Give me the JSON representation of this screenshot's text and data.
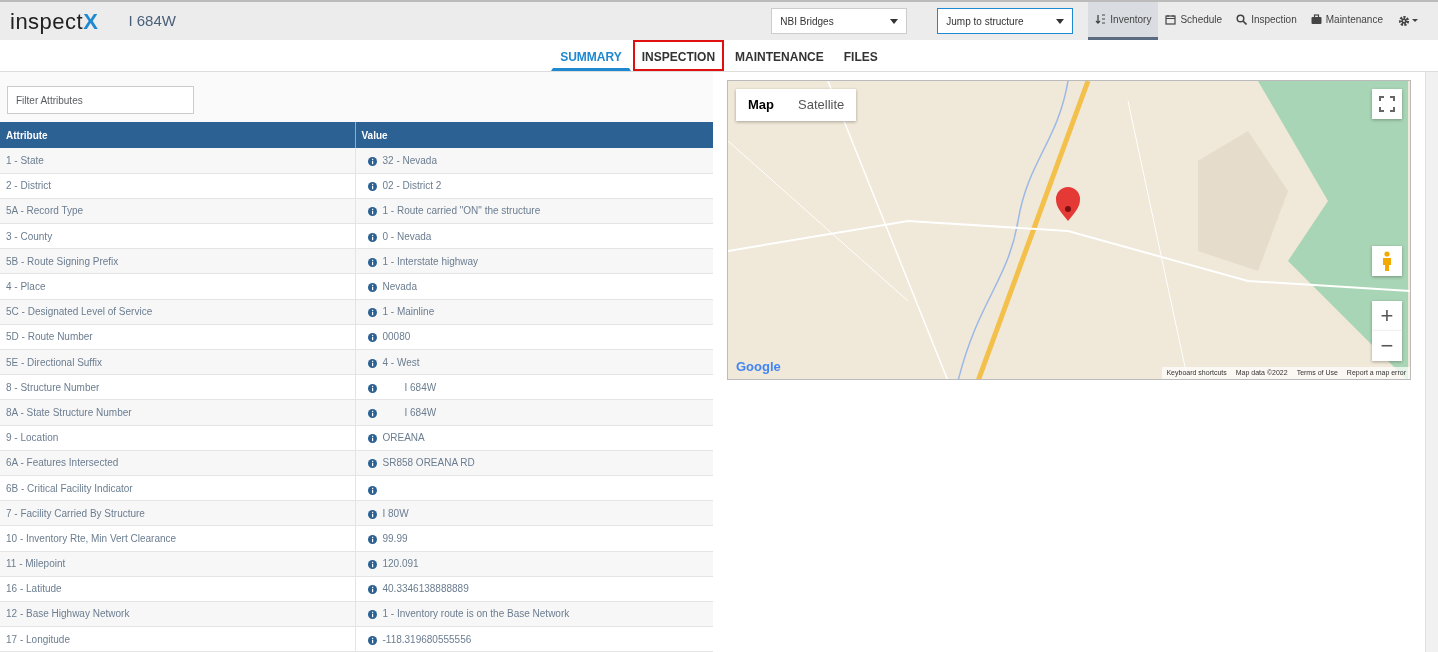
{
  "header": {
    "logo": {
      "text": "inspect",
      "accent": "X"
    },
    "structure": "I 684W",
    "selects": [
      {
        "value": "NBI Bridges",
        "focused": false
      },
      {
        "value": "Jump to structure",
        "focused": true
      }
    ],
    "nav": [
      {
        "label": "Inventory",
        "kind": "sort",
        "selected": true
      },
      {
        "label": "Schedule",
        "kind": "calendar",
        "selected": false
      },
      {
        "label": "Inspection",
        "kind": "search",
        "selected": false
      },
      {
        "label": "Maintenance",
        "kind": "briefcase",
        "selected": false
      }
    ]
  },
  "tabs": [
    {
      "label": "SUMMARY",
      "selected": true,
      "highlighted": false
    },
    {
      "label": "INSPECTION",
      "selected": false,
      "highlighted": true
    },
    {
      "label": "MAINTENANCE",
      "selected": false,
      "highlighted": false
    },
    {
      "label": "FILES",
      "selected": false,
      "highlighted": false
    }
  ],
  "filter": {
    "placeholder": "Filter Attributes"
  },
  "table": {
    "columns": [
      "Attribute",
      "Value"
    ],
    "rows": [
      {
        "attribute": "1 - State",
        "value": "32 - Nevada",
        "indented": false
      },
      {
        "attribute": "2 - District",
        "value": "02 - District 2",
        "indented": false
      },
      {
        "attribute": "5A - Record Type",
        "value": "1 - Route carried \"ON\" the structure",
        "indented": false
      },
      {
        "attribute": "3 - County",
        "value": "0 - Nevada",
        "indented": false
      },
      {
        "attribute": "5B - Route Signing Prefix",
        "value": "1 - Interstate highway",
        "indented": false
      },
      {
        "attribute": "4 - Place",
        "value": "Nevada",
        "indented": false
      },
      {
        "attribute": "5C - Designated Level of Service",
        "value": "1 - Mainline",
        "indented": false
      },
      {
        "attribute": "5D - Route Number",
        "value": "00080",
        "indented": false
      },
      {
        "attribute": "5E - Directional Suffix",
        "value": "4 - West",
        "indented": false
      },
      {
        "attribute": "8 - Structure Number",
        "value": "I 684W",
        "indented": true
      },
      {
        "attribute": "8A - State Structure Number",
        "value": "I 684W",
        "indented": true
      },
      {
        "attribute": "9 - Location",
        "value": "OREANA",
        "indented": false
      },
      {
        "attribute": "6A - Features Intersected",
        "value": "SR858 OREANA RD",
        "indented": false
      },
      {
        "attribute": "6B - Critical Facility Indicator"
      },
      {
        "attribute": "7 - Facility Carried By Structure",
        "value": "I 80W",
        "indented": false
      },
      {
        "attribute": "10 - Inventory Rte, Min Vert Clearance",
        "value": "99.99",
        "indented": false
      },
      {
        "attribute": "11 - Milepoint",
        "value": "120.091",
        "indented": false
      },
      {
        "attribute": "16 - Latitude",
        "value": "40.3346138888889",
        "indented": false
      },
      {
        "attribute": "12 - Base Highway Network",
        "value": "1 - Inventory route is on the Base Network",
        "indented": false
      },
      {
        "attribute": "17 - Longitude",
        "value": "-118.319680555556",
        "indented": false
      }
    ]
  },
  "map": {
    "kind": "picture",
    "types": [
      {
        "label": "Map",
        "selected": true
      },
      {
        "label": "Satellite",
        "selected": false
      }
    ],
    "zoom": [
      "+",
      "−"
    ],
    "logo": "Google",
    "footer": [
      "Keyboard shortcuts",
      "Map data ©2022",
      "Terms of Use",
      "Report a map error"
    ]
  }
}
